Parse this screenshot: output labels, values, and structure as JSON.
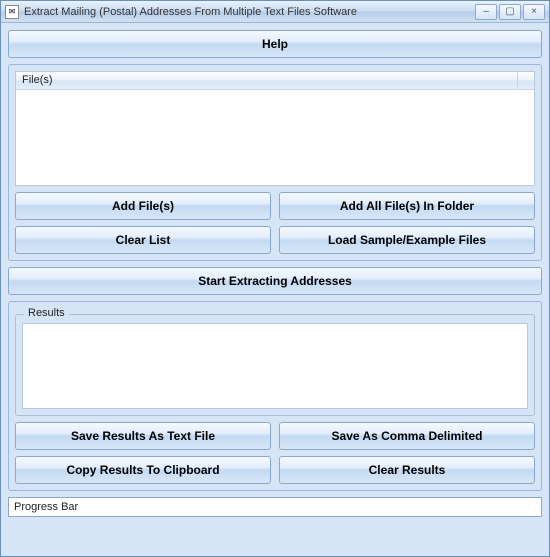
{
  "window": {
    "title": "Extract Mailing (Postal) Addresses From Multiple Text Files Software"
  },
  "help": {
    "label": "Help"
  },
  "files": {
    "header": "File(s)"
  },
  "buttons": {
    "add_files": "Add File(s)",
    "add_folder": "Add All File(s) In Folder",
    "clear_list": "Clear List",
    "load_sample": "Load Sample/Example Files",
    "start": "Start Extracting Addresses",
    "save_text": "Save Results As Text File",
    "save_csv": "Save As Comma Delimited",
    "copy_clip": "Copy Results To Clipboard",
    "clear_results": "Clear Results"
  },
  "results": {
    "legend": "Results"
  },
  "progress": {
    "label": "Progress Bar"
  }
}
